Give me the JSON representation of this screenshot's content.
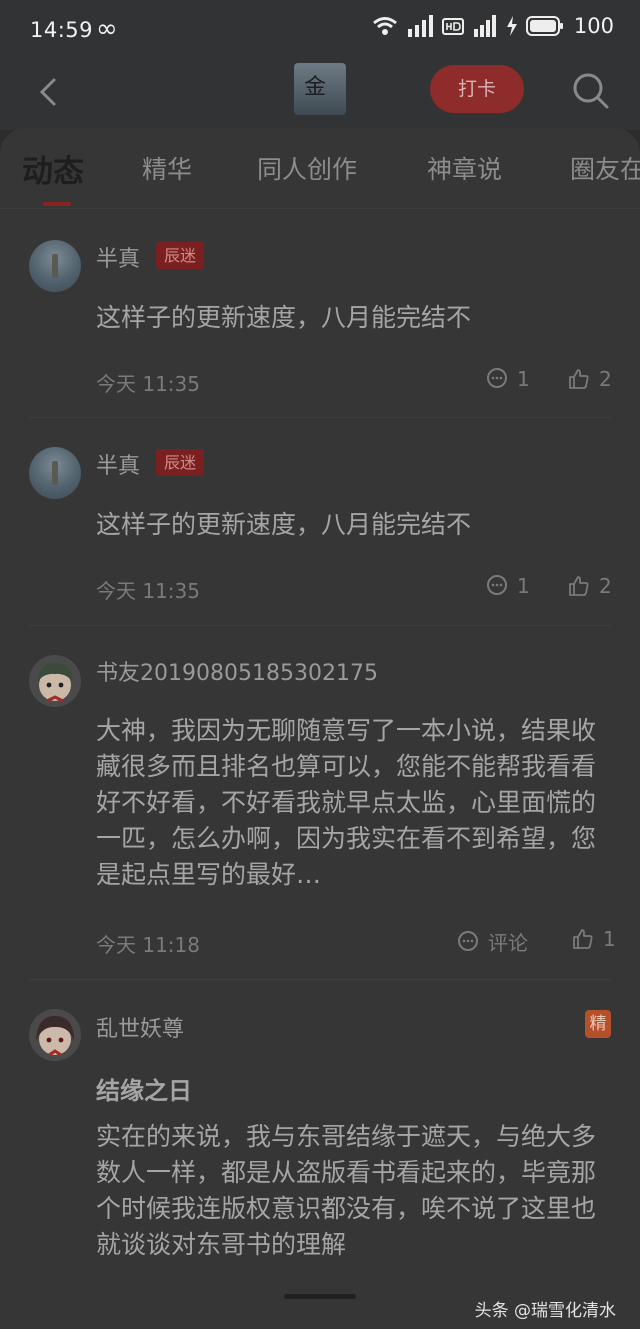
{
  "status_bar": {
    "time": "14:59",
    "infinity": "∞",
    "battery": "100"
  },
  "app_bar": {
    "logo_text": "金",
    "checkin_label": "打卡"
  },
  "tabs": [
    {
      "label": "动态"
    },
    {
      "label": "精华"
    },
    {
      "label": "同人创作"
    },
    {
      "label": "神章说"
    },
    {
      "label": "圈友在"
    }
  ],
  "posts": [
    {
      "username": "半真",
      "badge": "辰迷",
      "text": "这样子的更新速度，八月能完结不",
      "time": "今天 11:35",
      "comments": "1",
      "likes": "2"
    },
    {
      "username": "半真",
      "badge": "辰迷",
      "text": "这样子的更新速度，八月能完结不",
      "time": "今天 11:35",
      "comments": "1",
      "likes": "2"
    },
    {
      "username": "书友20190805185302175",
      "text": "大神，我因为无聊随意写了一本小说，结果收藏很多而且排名也算可以，您能不能帮我看看好不好看，不好看我就早点太监，心里面慌的一匹，怎么办啊，因为我实在看不到希望，您是起点里写的最好…",
      "time": "今天 11:18",
      "comments": "评论",
      "likes": "1"
    },
    {
      "username": "乱世妖尊",
      "featured": "精",
      "title": "结缘之日",
      "text": "实在的来说，我与东哥结缘于遮天，与绝大多数人一样，都是从盗版看书看起来的，毕竟那个时候我连版权意识都没有，唉不说了这里也就谈谈对东哥书的理解"
    }
  ],
  "watermark": "头条 @瑞雪化清水"
}
